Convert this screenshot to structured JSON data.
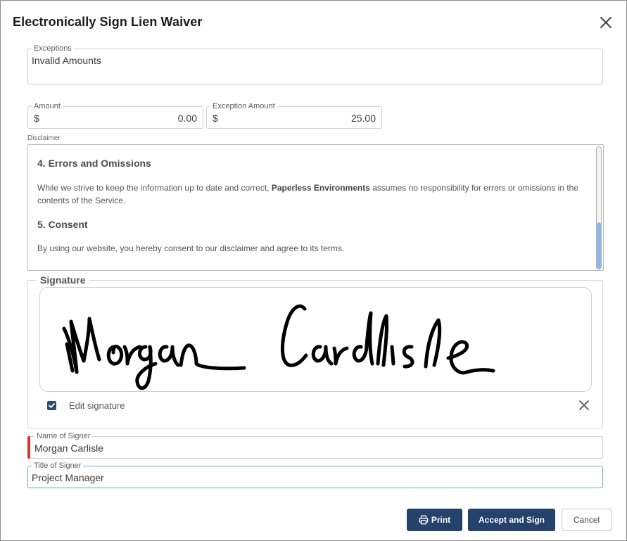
{
  "dialog": {
    "title": "Electronically Sign Lien Waiver",
    "close_icon": "close-icon"
  },
  "exceptions": {
    "label": "Exceptions",
    "value": "Invalid Amounts"
  },
  "amount": {
    "label": "Amount",
    "currency": "$",
    "value": "0.00"
  },
  "exception_amount": {
    "label": "Exception Amount",
    "currency": "$",
    "value": "25.00"
  },
  "disclaimer": {
    "label": "Disclaimer",
    "section4_heading": "4. Errors and Omissions",
    "section4_text_before": "While we strive to keep the information up to date and correct, ",
    "section4_bold": "Paperless Environments",
    "section4_text_after": " assumes no responsibility for errors or omissions in the contents of the Service.",
    "section5_heading": "5. Consent",
    "section5_text": "By using our website, you hereby consent to our disclaimer and agree to its terms."
  },
  "signature": {
    "legend": "Signature",
    "signed_name": "Morgan Carlisle",
    "edit_label": "Edit signature",
    "edit_checked": true
  },
  "signer": {
    "name_label": "Name of Signer",
    "name_value": "Morgan Carlisle",
    "title_label": "Title of Signer",
    "title_value": "Project Manager"
  },
  "buttons": {
    "print": "Print",
    "accept": "Accept and Sign",
    "cancel": "Cancel"
  },
  "colors": {
    "primary": "#24426a",
    "required_marker": "#e03131",
    "scroll_thumb": "#8fb7ee"
  }
}
